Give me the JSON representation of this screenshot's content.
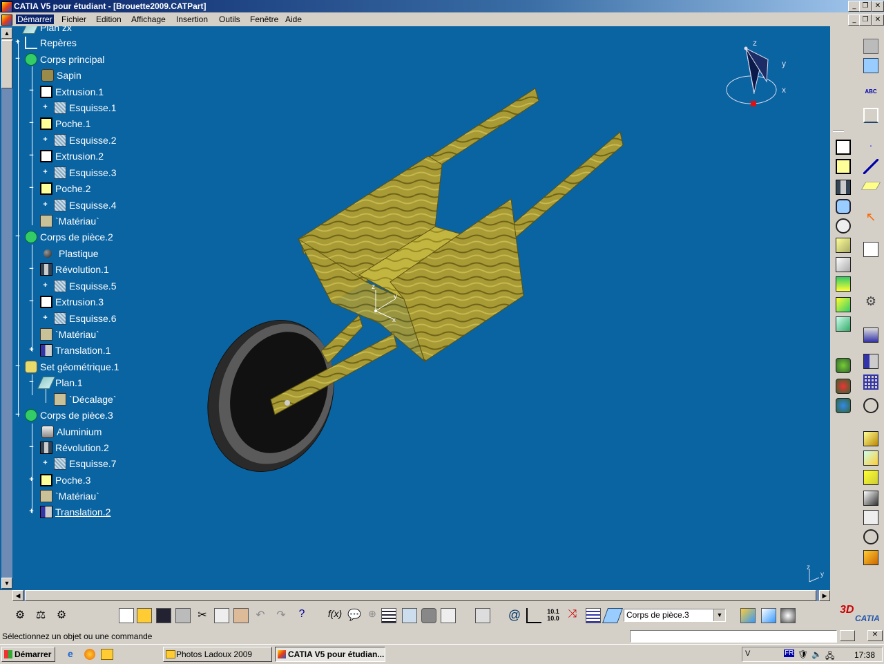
{
  "window": {
    "title": "CATIA V5 pour étudiant - [Brouette2009.CATPart]",
    "buttons": [
      "_",
      "❐",
      "✕"
    ]
  },
  "menu": {
    "items": [
      "Démarrer",
      "Fichier",
      "Edition",
      "Affichage",
      "Insertion",
      "Outils",
      "Fenêtre",
      "Aide"
    ]
  },
  "tree": {
    "items": [
      {
        "label": "Plan zx",
        "icon": "plane-icon"
      },
      {
        "label": "Repères",
        "icon": "axis-system-icon"
      },
      {
        "label": "Corps principal",
        "icon": "part-body-icon"
      },
      {
        "label": "Sapin",
        "icon": "material-icon"
      },
      {
        "label": "Extrusion.1",
        "icon": "pad-icon"
      },
      {
        "label": "Esquisse.1",
        "icon": "sketch-icon"
      },
      {
        "label": "Poche.1",
        "icon": "pocket-icon"
      },
      {
        "label": "Esquisse.2",
        "icon": "sketch-icon"
      },
      {
        "label": "Extrusion.2",
        "icon": "pad-icon"
      },
      {
        "label": "Esquisse.3",
        "icon": "sketch-icon"
      },
      {
        "label": "Poche.2",
        "icon": "pocket-icon"
      },
      {
        "label": "Esquisse.4",
        "icon": "sketch-icon"
      },
      {
        "label": "`Matériau`",
        "icon": "material-parameter-icon"
      },
      {
        "label": "Corps de pièce.2",
        "icon": "part-body-icon"
      },
      {
        "label": "Plastique",
        "icon": "material-ball-icon"
      },
      {
        "label": "Révolution.1",
        "icon": "shaft-icon"
      },
      {
        "label": "Esquisse.5",
        "icon": "sketch-icon"
      },
      {
        "label": "Extrusion.3",
        "icon": "pad-icon"
      },
      {
        "label": "Esquisse.6",
        "icon": "sketch-icon"
      },
      {
        "label": "`Matériau`",
        "icon": "material-parameter-icon"
      },
      {
        "label": "Translation.1",
        "icon": "translation-icon"
      },
      {
        "label": "Set géométrique.1",
        "icon": "geometrical-set-icon"
      },
      {
        "label": "Plan.1",
        "icon": "plane-icon"
      },
      {
        "label": "`Décalage`",
        "icon": "offset-parameter-icon"
      },
      {
        "label": "Corps de pièce.3",
        "icon": "part-body-icon"
      },
      {
        "label": "Aluminium",
        "icon": "material-icon"
      },
      {
        "label": "Révolution.2",
        "icon": "shaft-icon"
      },
      {
        "label": "Esquisse.7",
        "icon": "sketch-icon"
      },
      {
        "label": "Poche.3",
        "icon": "pocket-icon"
      },
      {
        "label": "`Matériau`",
        "icon": "material-parameter-icon"
      },
      {
        "label": "Translation.2",
        "icon": "translation-icon"
      }
    ]
  },
  "compass": {
    "x": "x",
    "y": "y",
    "z": "z"
  },
  "origin_axes": {
    "x": "x",
    "y": "y",
    "z": "z"
  },
  "corner_axes": {
    "y": "y",
    "z": "z"
  },
  "current_body": "Corps de pièce.3",
  "status": {
    "message": "Sélectionnez un objet ou une commande"
  },
  "brand": {
    "logo_text": "CATIA"
  },
  "taskbar": {
    "start": "Démarrer",
    "tasks": [
      "Photos Ladoux 2009",
      "CATIA V5 pour étudian..."
    ],
    "language": "FR",
    "clock": "17:38"
  },
  "colors": {
    "viewport_bg": "#0a64a2",
    "wood": "#a89a35",
    "wheel": "#3a3a3a"
  }
}
